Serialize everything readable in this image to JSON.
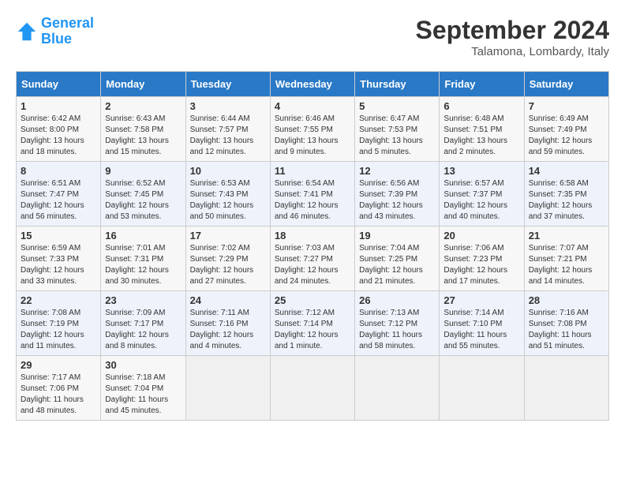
{
  "header": {
    "logo_text_general": "General",
    "logo_text_blue": "Blue",
    "month_year": "September 2024",
    "location": "Talamona, Lombardy, Italy"
  },
  "weekdays": [
    "Sunday",
    "Monday",
    "Tuesday",
    "Wednesday",
    "Thursday",
    "Friday",
    "Saturday"
  ],
  "weeks": [
    [
      {
        "day": "1",
        "sunrise": "6:42 AM",
        "sunset": "8:00 PM",
        "daylight": "13 hours and 18 minutes."
      },
      {
        "day": "2",
        "sunrise": "6:43 AM",
        "sunset": "7:58 PM",
        "daylight": "13 hours and 15 minutes."
      },
      {
        "day": "3",
        "sunrise": "6:44 AM",
        "sunset": "7:57 PM",
        "daylight": "13 hours and 12 minutes."
      },
      {
        "day": "4",
        "sunrise": "6:46 AM",
        "sunset": "7:55 PM",
        "daylight": "13 hours and 9 minutes."
      },
      {
        "day": "5",
        "sunrise": "6:47 AM",
        "sunset": "7:53 PM",
        "daylight": "13 hours and 5 minutes."
      },
      {
        "day": "6",
        "sunrise": "6:48 AM",
        "sunset": "7:51 PM",
        "daylight": "13 hours and 2 minutes."
      },
      {
        "day": "7",
        "sunrise": "6:49 AM",
        "sunset": "7:49 PM",
        "daylight": "12 hours and 59 minutes."
      }
    ],
    [
      {
        "day": "8",
        "sunrise": "6:51 AM",
        "sunset": "7:47 PM",
        "daylight": "12 hours and 56 minutes."
      },
      {
        "day": "9",
        "sunrise": "6:52 AM",
        "sunset": "7:45 PM",
        "daylight": "12 hours and 53 minutes."
      },
      {
        "day": "10",
        "sunrise": "6:53 AM",
        "sunset": "7:43 PM",
        "daylight": "12 hours and 50 minutes."
      },
      {
        "day": "11",
        "sunrise": "6:54 AM",
        "sunset": "7:41 PM",
        "daylight": "12 hours and 46 minutes."
      },
      {
        "day": "12",
        "sunrise": "6:56 AM",
        "sunset": "7:39 PM",
        "daylight": "12 hours and 43 minutes."
      },
      {
        "day": "13",
        "sunrise": "6:57 AM",
        "sunset": "7:37 PM",
        "daylight": "12 hours and 40 minutes."
      },
      {
        "day": "14",
        "sunrise": "6:58 AM",
        "sunset": "7:35 PM",
        "daylight": "12 hours and 37 minutes."
      }
    ],
    [
      {
        "day": "15",
        "sunrise": "6:59 AM",
        "sunset": "7:33 PM",
        "daylight": "12 hours and 33 minutes."
      },
      {
        "day": "16",
        "sunrise": "7:01 AM",
        "sunset": "7:31 PM",
        "daylight": "12 hours and 30 minutes."
      },
      {
        "day": "17",
        "sunrise": "7:02 AM",
        "sunset": "7:29 PM",
        "daylight": "12 hours and 27 minutes."
      },
      {
        "day": "18",
        "sunrise": "7:03 AM",
        "sunset": "7:27 PM",
        "daylight": "12 hours and 24 minutes."
      },
      {
        "day": "19",
        "sunrise": "7:04 AM",
        "sunset": "7:25 PM",
        "daylight": "12 hours and 21 minutes."
      },
      {
        "day": "20",
        "sunrise": "7:06 AM",
        "sunset": "7:23 PM",
        "daylight": "12 hours and 17 minutes."
      },
      {
        "day": "21",
        "sunrise": "7:07 AM",
        "sunset": "7:21 PM",
        "daylight": "12 hours and 14 minutes."
      }
    ],
    [
      {
        "day": "22",
        "sunrise": "7:08 AM",
        "sunset": "7:19 PM",
        "daylight": "12 hours and 11 minutes."
      },
      {
        "day": "23",
        "sunrise": "7:09 AM",
        "sunset": "7:17 PM",
        "daylight": "12 hours and 8 minutes."
      },
      {
        "day": "24",
        "sunrise": "7:11 AM",
        "sunset": "7:16 PM",
        "daylight": "12 hours and 4 minutes."
      },
      {
        "day": "25",
        "sunrise": "7:12 AM",
        "sunset": "7:14 PM",
        "daylight": "12 hours and 1 minute."
      },
      {
        "day": "26",
        "sunrise": "7:13 AM",
        "sunset": "7:12 PM",
        "daylight": "11 hours and 58 minutes."
      },
      {
        "day": "27",
        "sunrise": "7:14 AM",
        "sunset": "7:10 PM",
        "daylight": "11 hours and 55 minutes."
      },
      {
        "day": "28",
        "sunrise": "7:16 AM",
        "sunset": "7:08 PM",
        "daylight": "11 hours and 51 minutes."
      }
    ],
    [
      {
        "day": "29",
        "sunrise": "7:17 AM",
        "sunset": "7:06 PM",
        "daylight": "11 hours and 48 minutes."
      },
      {
        "day": "30",
        "sunrise": "7:18 AM",
        "sunset": "7:04 PM",
        "daylight": "11 hours and 45 minutes."
      },
      null,
      null,
      null,
      null,
      null
    ]
  ]
}
